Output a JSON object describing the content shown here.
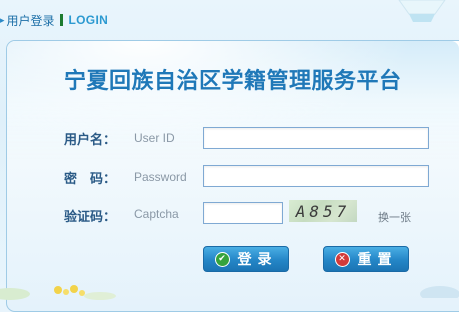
{
  "topbar": {
    "login_cn": "用户登录",
    "login_en": "LOGIN"
  },
  "title": "宁夏回族自治区学籍管理服务平台",
  "form": {
    "username_label": "用户名：",
    "username_placeholder": "User ID",
    "password_label": "密　码：",
    "password_placeholder": "Password",
    "captcha_label": "验证码：",
    "captcha_placeholder": "Captcha",
    "captcha_text": "A857",
    "change_captcha": "换一张"
  },
  "buttons": {
    "login": "登录",
    "reset": "重置"
  },
  "colors": {
    "title": "#1f78b8",
    "label": "#2a5a86",
    "button": "#2486c7",
    "login_icon": "#35a33d",
    "reset_icon": "#d23a3a"
  },
  "icons": {
    "login": "check-icon",
    "reset": "x-icon"
  }
}
